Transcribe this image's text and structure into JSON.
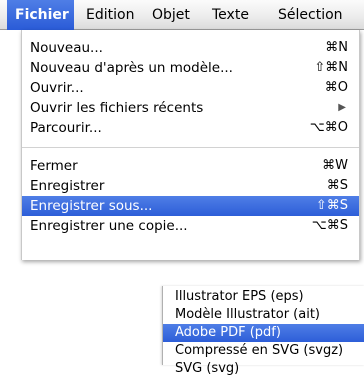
{
  "menubar": {
    "items": [
      {
        "label": "Fichier",
        "active": true
      },
      {
        "label": "Edition"
      },
      {
        "label": "Objet"
      },
      {
        "label": "Texte"
      },
      {
        "label": "Sélection"
      }
    ]
  },
  "file_menu": {
    "items": [
      {
        "label": "Nouveau...",
        "shortcut": "⌘N"
      },
      {
        "label": "Nouveau d'après un modèle...",
        "shortcut": "⇧⌘N"
      },
      {
        "label": "Ouvrir...",
        "shortcut": "⌘O"
      },
      {
        "label": "Ouvrir les fichiers récents",
        "has_submenu": true
      },
      {
        "label": "Parcourir...",
        "shortcut": "⌥⌘O"
      },
      {
        "label": "Fermer",
        "shortcut": "⌘W"
      },
      {
        "label": "Enregistrer",
        "shortcut": "⌘S"
      },
      {
        "label": "Enregistrer sous...",
        "shortcut": "⇧⌘S",
        "highlighted": true
      },
      {
        "label": "Enregistrer une copie...",
        "shortcut": "⌥⌘S"
      }
    ]
  },
  "save_format_menu": {
    "items": [
      {
        "label": "Illustrator EPS (eps)"
      },
      {
        "label": "Modèle Illustrator (ait)"
      },
      {
        "label": "Adobe PDF (pdf)",
        "highlighted": true
      },
      {
        "label": "Compressé en SVG (svgz)"
      },
      {
        "label": "SVG (svg)"
      }
    ]
  },
  "colors": {
    "highlight": "#2d5ed8",
    "menubar_bg": "#ededed"
  },
  "icons": {
    "submenu_arrow": "triangle-right-icon"
  }
}
